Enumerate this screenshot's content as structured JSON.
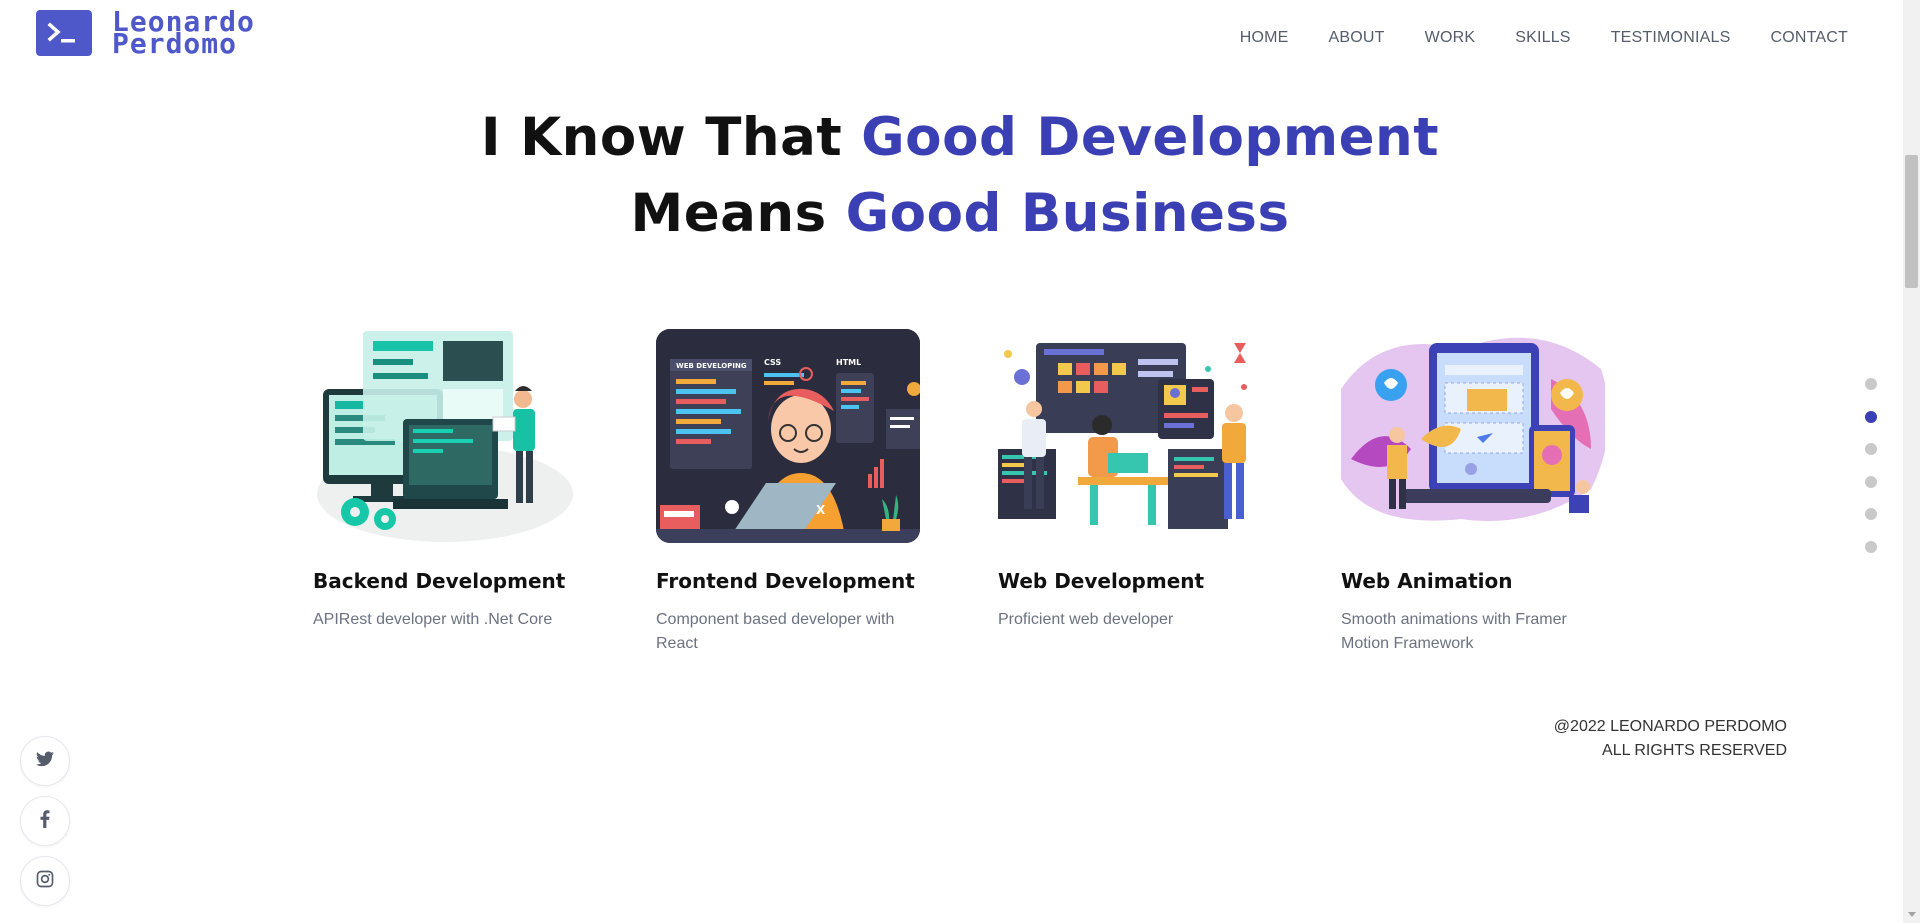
{
  "brand": {
    "line1": "Leonardo",
    "line2": "Perdomo",
    "color": "#4f58c9"
  },
  "nav": {
    "items": [
      {
        "label": "HOME"
      },
      {
        "label": "ABOUT"
      },
      {
        "label": "WORK"
      },
      {
        "label": "SKILLS"
      },
      {
        "label": "TESTIMONIALS"
      },
      {
        "label": "CONTACT"
      }
    ]
  },
  "headline": {
    "line1_plain": "I Know That ",
    "line1_accent": "Good Development",
    "line2_plain": "Means ",
    "line2_accent": "Good Business",
    "accent_color": "#3a3fb4"
  },
  "services": [
    {
      "title": "Backend Development",
      "description": "APIRest developer with .Net Core",
      "illustration": "backend-illustration"
    },
    {
      "title": "Frontend Development",
      "description": "Component based developer with React",
      "illustration": "frontend-illustration"
    },
    {
      "title": "Web Development",
      "description": "Proficient web developer",
      "illustration": "web-dev-illustration"
    },
    {
      "title": "Web Animation",
      "description": "Smooth animations with Framer Motion Framework",
      "illustration": "web-animation-illustration"
    }
  ],
  "section_dots": {
    "count": 6,
    "active_index": 1
  },
  "footer": {
    "line1": "@2022 LEONARDO PERDOMO",
    "line2": "ALL RIGHTS RESERVED"
  },
  "socials": [
    {
      "icon": "twitter-icon"
    },
    {
      "icon": "facebook-icon"
    },
    {
      "icon": "instagram-icon"
    }
  ]
}
